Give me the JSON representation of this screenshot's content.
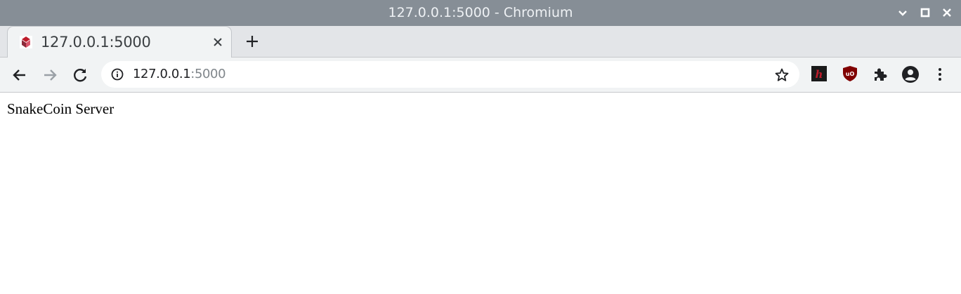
{
  "window": {
    "title": "127.0.0.1:5000 - Chromium"
  },
  "tabs": [
    {
      "title": "127.0.0.1:5000",
      "favicon": "snakecoin-favicon",
      "active": true
    }
  ],
  "toolbar": {
    "url_host": "127.0.0.1",
    "url_port": ":5000",
    "icons": [
      "back-arrow-icon",
      "forward-arrow-icon",
      "reload-icon",
      "info-icon",
      "star-icon",
      "hypothesis-extension-icon",
      "ublock-extension-icon",
      "extensions-puzzle-icon",
      "profile-icon",
      "menu-icon"
    ]
  },
  "page": {
    "text": "SnakeCoin Server"
  },
  "colors": {
    "titlebar": "#868e96",
    "tabstrip": "#e3e5e8",
    "toolbar": "#f1f3f4",
    "ublock_red": "#800000",
    "hypothesis_red": "#bd1c2b"
  }
}
